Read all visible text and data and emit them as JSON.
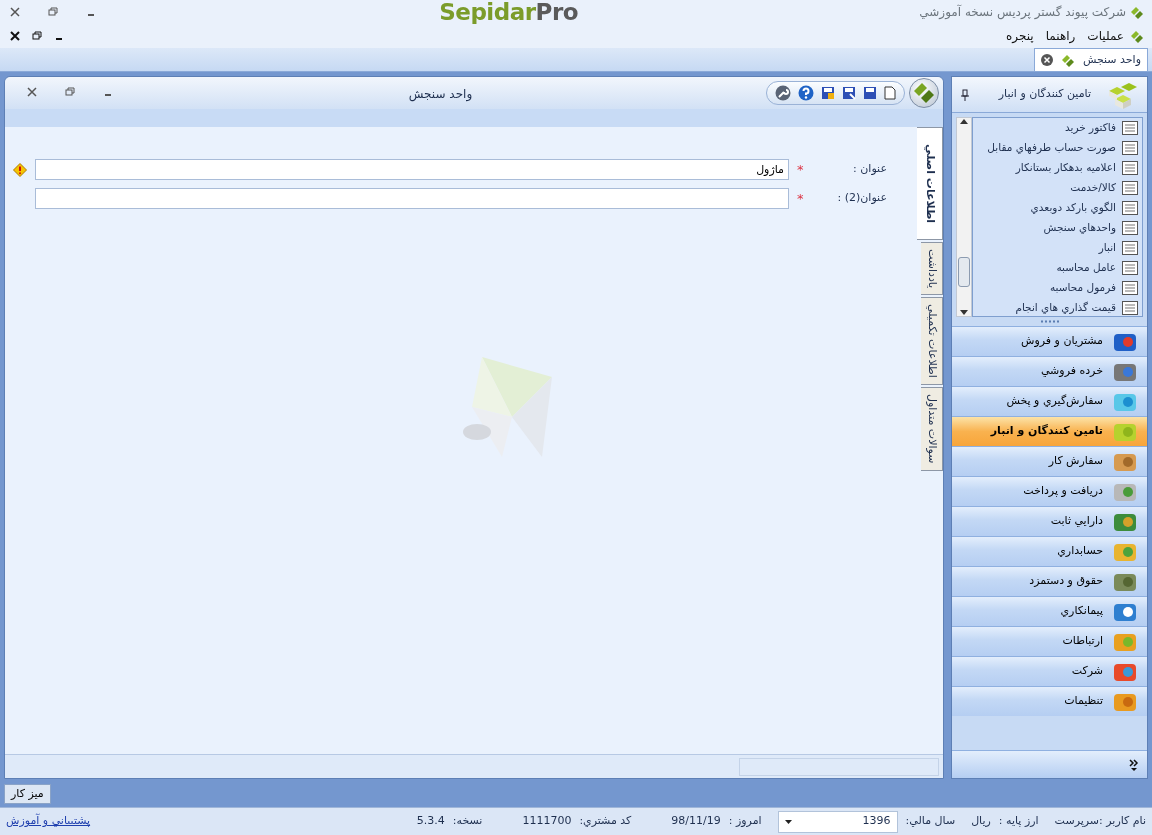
{
  "title_bar": {
    "company": "شرکت پیوند گستر پردیس نسخه آموزشي",
    "logo_main": "Sepidar",
    "logo_suffix": "Pro"
  },
  "menu": [
    {
      "label": "عمليات"
    },
    {
      "label": "راهنما"
    },
    {
      "label": "پنجره"
    }
  ],
  "document_tabs": [
    {
      "label": "واحد سنجش",
      "selected": true
    }
  ],
  "form_window": {
    "title": "واحد سنجش",
    "fields": [
      {
        "label": "عنوان :",
        "required_mark": "*",
        "value": "ماژول",
        "warning": true
      },
      {
        "label": "عنوان(2) :",
        "required_mark": "*",
        "warning": false
      }
    ],
    "side_tabs": [
      {
        "label": "اطلاعات اصلي",
        "selected": true
      },
      {
        "label": "يادداشت",
        "selected": false
      },
      {
        "label": "اطلاعات تكميلي",
        "selected": false
      },
      {
        "label": "سوالات متداول",
        "selected": false
      }
    ]
  },
  "navigator": {
    "title": "تامين کنندگان و انبار",
    "items": [
      {
        "label": "فاكتور خريد"
      },
      {
        "label": "صورت حساب طرفهاي مقابل"
      },
      {
        "label": "اعلاميه بدهكار بستانكار"
      },
      {
        "label": "كالا/خدمت"
      },
      {
        "label": "الگوي باركد دوبعدي"
      },
      {
        "label": "واحدهاي سنجش"
      },
      {
        "label": "انبار"
      },
      {
        "label": "عامل محاسبه"
      },
      {
        "label": "فرمول محاسبه"
      },
      {
        "label": "قيمت گذاري هاي انجام"
      }
    ],
    "modules": [
      {
        "label": "مشتريان و فروش",
        "selected": false
      },
      {
        "label": "خرده فروشي",
        "selected": false
      },
      {
        "label": "سفارش‌گيري و پخش",
        "selected": false
      },
      {
        "label": "تامين کنندگان و انبار",
        "selected": true
      },
      {
        "label": "سفارش كار",
        "selected": false
      },
      {
        "label": "دريافت و پرداخت",
        "selected": false
      },
      {
        "label": "دارايي ثابت",
        "selected": false
      },
      {
        "label": "حسابداري",
        "selected": false
      },
      {
        "label": "حقوق و دستمزد",
        "selected": false
      },
      {
        "label": "پيمانكاري",
        "selected": false
      },
      {
        "label": "ارتباطات",
        "selected": false
      },
      {
        "label": "شركت",
        "selected": false
      },
      {
        "label": "تنظيمات",
        "selected": false
      }
    ]
  },
  "taskbar": {
    "button": "ميز كار"
  },
  "status_bar": {
    "user": "نام كاربر :سرپرست",
    "currency_label": "ارز پايه :",
    "currency": "ريال",
    "fiscal_year_label": "سال مالي:",
    "fiscal_year": "1396",
    "today_label": "امروز :",
    "today": "98/11/19",
    "customer_code_label": "كد مشتري:",
    "customer_code": "1111700",
    "version_label": "نسخه:",
    "version": "5.3.4",
    "support_link": "پشتيباني و آموزش"
  }
}
